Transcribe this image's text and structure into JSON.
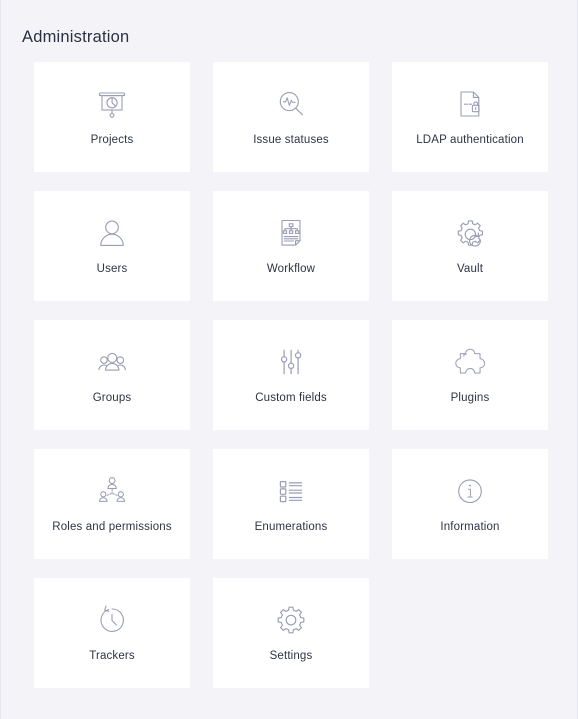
{
  "page": {
    "title": "Administration",
    "background_color": "#f4f4f8",
    "tile_background_color": "#ffffff",
    "icon_color": "#9a9cb4",
    "label_color": "#2f3347"
  },
  "tiles": [
    {
      "label": "Projects",
      "icon": "presentation-chart-icon"
    },
    {
      "label": "Issue statuses",
      "icon": "magnifier-pulse-icon"
    },
    {
      "label": "LDAP authentication",
      "icon": "document-lock-icon"
    },
    {
      "label": "Users",
      "icon": "user-icon"
    },
    {
      "label": "Workflow",
      "icon": "document-flowchart-icon"
    },
    {
      "label": "Vault",
      "icon": "gear-refresh-icon"
    },
    {
      "label": "Groups",
      "icon": "users-group-icon"
    },
    {
      "label": "Custom fields",
      "icon": "sliders-icon"
    },
    {
      "label": "Plugins",
      "icon": "puzzle-cog-icon"
    },
    {
      "label": "Roles and permissions",
      "icon": "org-chart-people-icon"
    },
    {
      "label": "Enumerations",
      "icon": "checklist-icon"
    },
    {
      "label": "Information",
      "icon": "info-circle-icon"
    },
    {
      "label": "Trackers",
      "icon": "clock-history-icon"
    },
    {
      "label": "Settings",
      "icon": "gear-icon"
    }
  ]
}
